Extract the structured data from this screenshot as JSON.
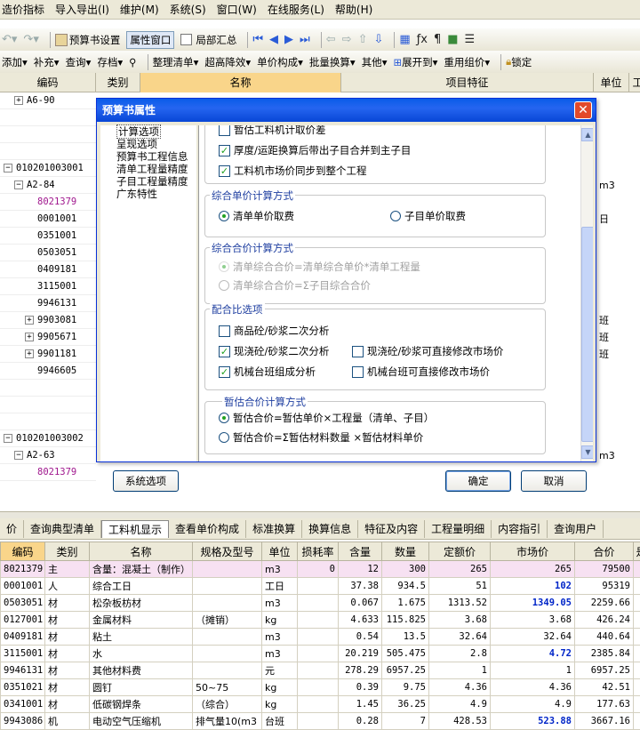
{
  "menu": [
    "造价指标",
    "导入导出(I)",
    "维护(M)",
    "系统(S)",
    "窗口(W)",
    "在线服务(L)",
    "帮助(H)"
  ],
  "toolbar1": {
    "budget_settings": "预算书设置",
    "property_window": "属性窗口",
    "partial_summary": "局部汇总"
  },
  "toolbar2": [
    "添加",
    "补充",
    "查询",
    "存档",
    "整理清单",
    "超高降效",
    "单价构成",
    "批量换算",
    "其他",
    "展开到",
    "重用组价",
    "锁定"
  ],
  "grid_header": {
    "code": "编码",
    "category": "类别",
    "name": "名称",
    "feature": "项目特征",
    "unit": "单位",
    "extra": "工"
  },
  "left_rows": [
    {
      "indent": 1,
      "exp": "+",
      "code": "A6-90"
    },
    {
      "indent": 0,
      "exp": "",
      "code": ""
    },
    {
      "indent": 0,
      "exp": "",
      "code": ""
    },
    {
      "indent": 0,
      "exp": "",
      "code": ""
    },
    {
      "indent": 0,
      "exp": "−",
      "code": "010201003001"
    },
    {
      "indent": 1,
      "exp": "−",
      "code": "A2-84"
    },
    {
      "indent": 2,
      "exp": "",
      "code": "8021379",
      "purple": true
    },
    {
      "indent": 2,
      "exp": "",
      "code": "0001001"
    },
    {
      "indent": 2,
      "exp": "",
      "code": "0351001"
    },
    {
      "indent": 2,
      "exp": "",
      "code": "0503051"
    },
    {
      "indent": 2,
      "exp": "",
      "code": "0409181"
    },
    {
      "indent": 2,
      "exp": "",
      "code": "3115001"
    },
    {
      "indent": 2,
      "exp": "",
      "code": "9946131"
    },
    {
      "indent": 2,
      "exp": "+",
      "code": "9903081"
    },
    {
      "indent": 2,
      "exp": "+",
      "code": "9905671"
    },
    {
      "indent": 2,
      "exp": "+",
      "code": "9901181"
    },
    {
      "indent": 2,
      "exp": "",
      "code": "9946605"
    },
    {
      "indent": 0,
      "exp": "",
      "code": ""
    },
    {
      "indent": 0,
      "exp": "",
      "code": ""
    },
    {
      "indent": 0,
      "exp": "",
      "code": ""
    },
    {
      "indent": 0,
      "exp": "−",
      "code": "010201003002"
    },
    {
      "indent": 1,
      "exp": "−",
      "code": "A2-63"
    },
    {
      "indent": 2,
      "exp": "",
      "code": "8021379",
      "purple": true
    }
  ],
  "right_units": [
    {
      "row": 5,
      "text": "m3"
    },
    {
      "row": 7,
      "text": "日"
    },
    {
      "row": 13,
      "text": "班"
    },
    {
      "row": 14,
      "text": "班"
    },
    {
      "row": 15,
      "text": "班"
    },
    {
      "row": 21,
      "text": "m3"
    }
  ],
  "dialog": {
    "title": "预算书属性",
    "tree": [
      "计算选项",
      "呈现选项",
      "预算书工程信息",
      "清单工程量精度",
      "子目工程量精度",
      "广东特性"
    ],
    "opt_top_cut": "暂估工料机计取价差",
    "opt_thickness": "厚度/运距换算后带出子目合并到主子目",
    "opt_sync_price": "工料机市场价同步到整个工程",
    "grp1_title": "综合单价计算方式",
    "grp1_opt1": "清单单价取费",
    "grp1_opt2": "子目单价取费",
    "grp2_title": "综合合价计算方式",
    "grp2_opt1": "清单综合合价=清单综合单价*清单工程量",
    "grp2_opt2": "清单综合合价=Σ子目综合合价",
    "grp3_title": "配合比选项",
    "grp3_opt1": "商品砼/砂浆二次分析",
    "grp3_opt2": "现浇砼/砂浆二次分析",
    "grp3_opt3": "现浇砼/砂浆可直接修改市场价",
    "grp3_opt4": "机械台班组成分析",
    "grp3_opt5": "机械台班可直接修改市场价",
    "grp4_title": "暂估合价计算方式",
    "grp4_opt1": "暂估合价=暂估单价×工程量（清单、子目）",
    "grp4_opt2": "暂估合价=Σ暂估材料数量 ×暂估材料单价",
    "btn_system": "系统选项",
    "btn_ok": "确定",
    "btn_cancel": "取消"
  },
  "bottom_tabs": [
    "价",
    "查询典型清单",
    "工料机显示",
    "查看单价构成",
    "标准换算",
    "换算信息",
    "特征及内容",
    "工程量明细",
    "内容指引",
    "查询用户"
  ],
  "bottom_active_tab": 2,
  "table": {
    "headers": [
      "编码",
      "类别",
      "名称",
      "规格及型号",
      "单位",
      "损耗率",
      "含量",
      "数量",
      "定额价",
      "市场价",
      "合价",
      "是"
    ],
    "rows": [
      [
        "8021379",
        "主",
        "含量：混凝土（制作）",
        "",
        "m3",
        "0",
        "12",
        "300",
        "265",
        "265",
        "79500"
      ],
      [
        "0001001",
        "人",
        "综合工日",
        "",
        "工日",
        "",
        "37.38",
        "934.5",
        "51",
        "102",
        "95319"
      ],
      [
        "0503051",
        "材",
        "松杂板枋材",
        "",
        "m3",
        "",
        "0.067",
        "1.675",
        "1313.52",
        "1349.05",
        "2259.66"
      ],
      [
        "0127001",
        "材",
        "金属材料",
        "（摊销）",
        "kg",
        "",
        "4.633",
        "115.825",
        "3.68",
        "3.68",
        "426.24"
      ],
      [
        "0409181",
        "材",
        "粘土",
        "",
        "m3",
        "",
        "0.54",
        "13.5",
        "32.64",
        "32.64",
        "440.64"
      ],
      [
        "3115001",
        "材",
        "水",
        "",
        "m3",
        "",
        "20.219",
        "505.475",
        "2.8",
        "4.72",
        "2385.84"
      ],
      [
        "9946131",
        "材",
        "其他材料费",
        "",
        "元",
        "",
        "278.29",
        "6957.25",
        "1",
        "1",
        "6957.25"
      ],
      [
        "0351021",
        "材",
        "圆钉",
        "50~75",
        "kg",
        "",
        "0.39",
        "9.75",
        "4.36",
        "4.36",
        "42.51"
      ],
      [
        "0341001",
        "材",
        "低碳钢焊条",
        "（综合）",
        "kg",
        "",
        "1.45",
        "36.25",
        "4.9",
        "4.9",
        "177.63"
      ],
      [
        "9943086",
        "机",
        "电动空气压缩机",
        "排气量10(m3",
        "台班",
        "",
        "0.28",
        "7",
        "428.53",
        "523.88",
        "3667.16"
      ]
    ],
    "blue_market_rows": [
      1,
      2,
      5,
      9
    ]
  },
  "colors": {
    "title_blue": "#0a5ce8",
    "highlight_row": "#f7e1f2",
    "check_green": "#21a121",
    "market_blue": "#0025c8"
  }
}
